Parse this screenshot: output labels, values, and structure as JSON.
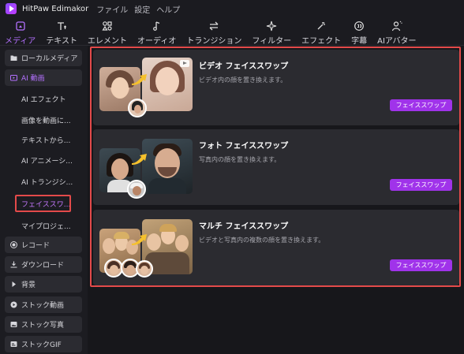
{
  "app": {
    "title": "HitPaw Edimakor"
  },
  "menu": [
    "ファイル",
    "設定",
    "ヘルプ"
  ],
  "toolbar": [
    {
      "label": "メディア",
      "icon": "media-icon",
      "active": true
    },
    {
      "label": "テキスト",
      "icon": "text-icon",
      "active": false
    },
    {
      "label": "エレメント",
      "icon": "element-icon",
      "active": false
    },
    {
      "label": "オーディオ",
      "icon": "audio-icon",
      "active": false
    },
    {
      "label": "トランジション",
      "icon": "transition-icon",
      "active": false
    },
    {
      "label": "フィルター",
      "icon": "filter-icon",
      "active": false
    },
    {
      "label": "エフェクト",
      "icon": "effect-icon",
      "active": false
    },
    {
      "label": "字幕",
      "icon": "subtitle-icon",
      "active": false
    },
    {
      "label": "AIアバター",
      "icon": "avatar-icon",
      "active": false
    }
  ],
  "sidebar": {
    "local_media": "ローカルメディア",
    "ai_video": "AI 動画",
    "ai_sub": [
      "AI エフェクト",
      "画像を動画に...",
      "テキストから...",
      "AI アニメーシ...",
      "AI トランジシ..."
    ],
    "face_swap": "フェイススワ...",
    "my_project": "マイプロジェ...",
    "record": "レコード",
    "download": "ダウンロード",
    "background": "背景",
    "stock_video": "ストック動画",
    "stock_photo": "ストック写真",
    "stock_gif": "ストックGIF"
  },
  "cards": [
    {
      "title": "ビデオ フェイススワップ",
      "desc": "ビデオ内の顔を置き換えます。",
      "button": "フェイススワップ"
    },
    {
      "title": "フォト フェイススワップ",
      "desc": "写真内の顔を置き換えます。",
      "button": "フェイススワップ"
    },
    {
      "title": "マルチ フェイススワップ",
      "desc": "ビデオと写真内の複数の顔を置き換えます。",
      "button": "フェイススワップ"
    }
  ],
  "colors": {
    "accent": "#a033ea",
    "highlight": "#e34a4a",
    "active_text": "#b471ff"
  }
}
